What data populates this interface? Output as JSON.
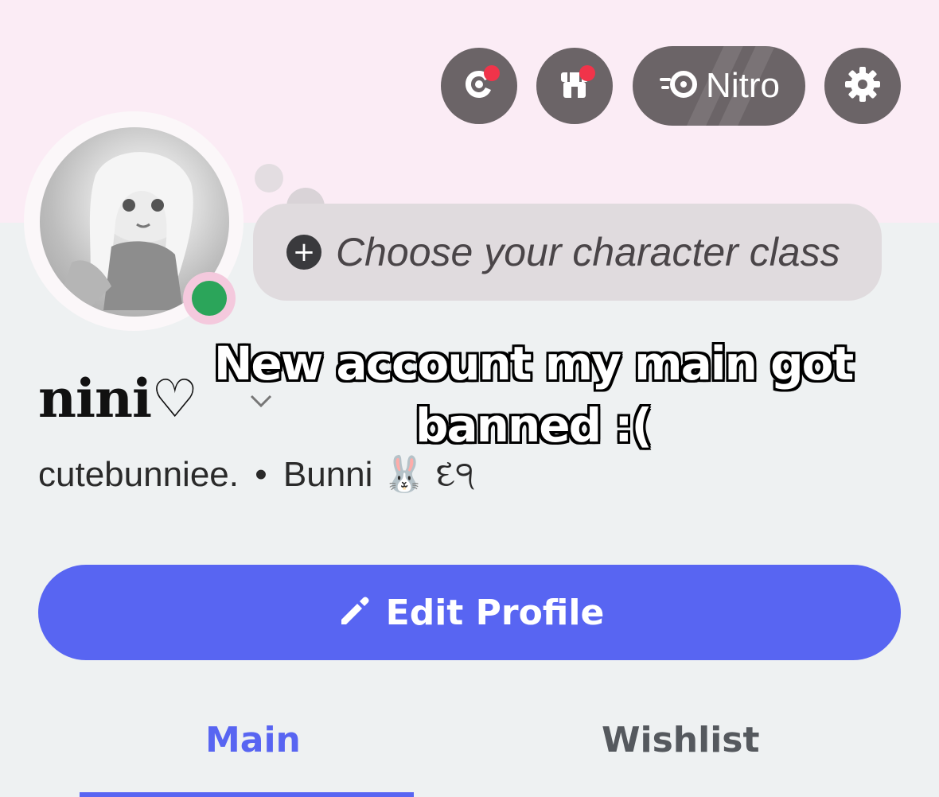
{
  "header": {
    "icons": [
      "quest-icon",
      "shop-icon",
      "nitro-icon",
      "settings-icon"
    ],
    "nitro_label": "Nitro"
  },
  "profile": {
    "display_name": "nini♡",
    "username": "cutebunniee.",
    "separator": "•",
    "pronouns": "Bunni 🐰 દ੧",
    "status": "online",
    "class_prompt": "Choose your character class"
  },
  "overlay_caption": "New account my main got banned :(",
  "actions": {
    "edit_profile_label": "Edit Profile"
  },
  "tabs": [
    {
      "label": "Main",
      "active": true
    },
    {
      "label": "Wishlist",
      "active": false
    }
  ],
  "colors": {
    "accent": "#5865f2",
    "banner": "#fbecf5",
    "online": "#2ba55a",
    "notification": "#f0344a"
  }
}
